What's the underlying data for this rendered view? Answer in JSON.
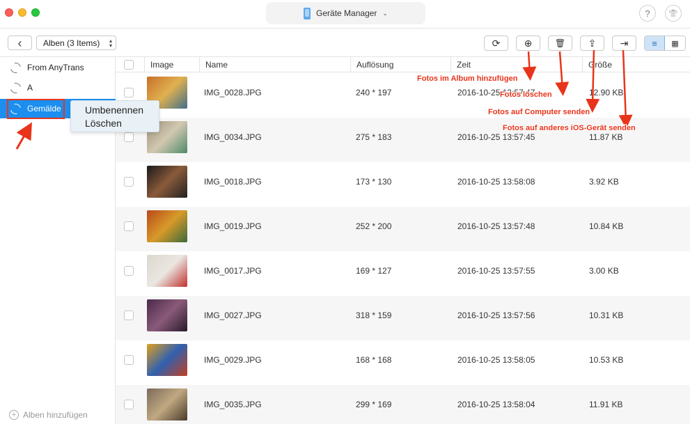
{
  "titlebar": {
    "device_name": "Geräte Manager",
    "help_glyph": "?",
    "shirt_glyph": "👕"
  },
  "toolbar": {
    "back_glyph": "‹",
    "album_select": "Alben (3 Items)",
    "refresh_glyph": "⟳",
    "add_glyph": "⊕",
    "delete_glyph": "🗑",
    "computer_glyph": "⇪",
    "device_glyph": "⇥",
    "list_glyph": "≡",
    "grid_glyph": "▦"
  },
  "sidebar": {
    "items": [
      {
        "label": "From AnyTrans"
      },
      {
        "label": "A"
      },
      {
        "label": "Gemälde",
        "selected": true
      }
    ],
    "add_album": "Alben hinzufügen"
  },
  "context_menu": {
    "items": [
      "Umbenennen",
      "Löschen"
    ]
  },
  "table": {
    "columns": [
      "Image",
      "Name",
      "Auflösung",
      "Zeit",
      "Größe"
    ],
    "rows": [
      {
        "name": "IMG_0028.JPG",
        "resolution": "240 * 197",
        "time": "2016-10-25 13:57:47",
        "size": "12.90 KB",
        "thumb_colors": [
          "#c8702a",
          "#e0b050",
          "#40708a"
        ]
      },
      {
        "name": "IMG_0034.JPG",
        "resolution": "275 * 183",
        "time": "2016-10-25 13:57:45",
        "size": "11.87 KB",
        "thumb_colors": [
          "#9a8f7a",
          "#d2c8b0",
          "#4f8a6a"
        ]
      },
      {
        "name": "IMG_0018.JPG",
        "resolution": "173 * 130",
        "time": "2016-10-25 13:58:08",
        "size": "3.92 KB",
        "thumb_colors": [
          "#1a1a1a",
          "#8a5a3a",
          "#222222"
        ]
      },
      {
        "name": "IMG_0019.JPG",
        "resolution": "252 * 200",
        "time": "2016-10-25 13:57:48",
        "size": "10.84 KB",
        "thumb_colors": [
          "#b84a1a",
          "#d89a2a",
          "#3a6a3a"
        ]
      },
      {
        "name": "IMG_0017.JPG",
        "resolution": "169 * 127",
        "time": "2016-10-25 13:57:55",
        "size": "3.00 KB",
        "thumb_colors": [
          "#dcd8d0",
          "#eae6e0",
          "#c03030"
        ]
      },
      {
        "name": "IMG_0027.JPG",
        "resolution": "318 * 159",
        "time": "2016-10-25 13:57:56",
        "size": "10.31 KB",
        "thumb_colors": [
          "#4a2a4a",
          "#8a5a7a",
          "#2a1a2a"
        ]
      },
      {
        "name": "IMG_0029.JPG",
        "resolution": "168 * 168",
        "time": "2016-10-25 13:58:05",
        "size": "10.53 KB",
        "thumb_colors": [
          "#e0a020",
          "#3060b0",
          "#c04020"
        ]
      },
      {
        "name": "IMG_0035.JPG",
        "resolution": "299 * 169",
        "time": "2016-10-25 13:58:04",
        "size": "11.91 KB",
        "thumb_colors": [
          "#7a6a5a",
          "#c0a880",
          "#4a3a2a"
        ]
      }
    ]
  },
  "annotations": {
    "add_photos": "Fotos im Album  hinzufügen",
    "delete_photos": "Fotos löschen",
    "send_computer": "Fotos auf Computer senden",
    "send_ios": "Fotos auf anderes iOS-Gerät senden",
    "color": "#e8341b"
  }
}
